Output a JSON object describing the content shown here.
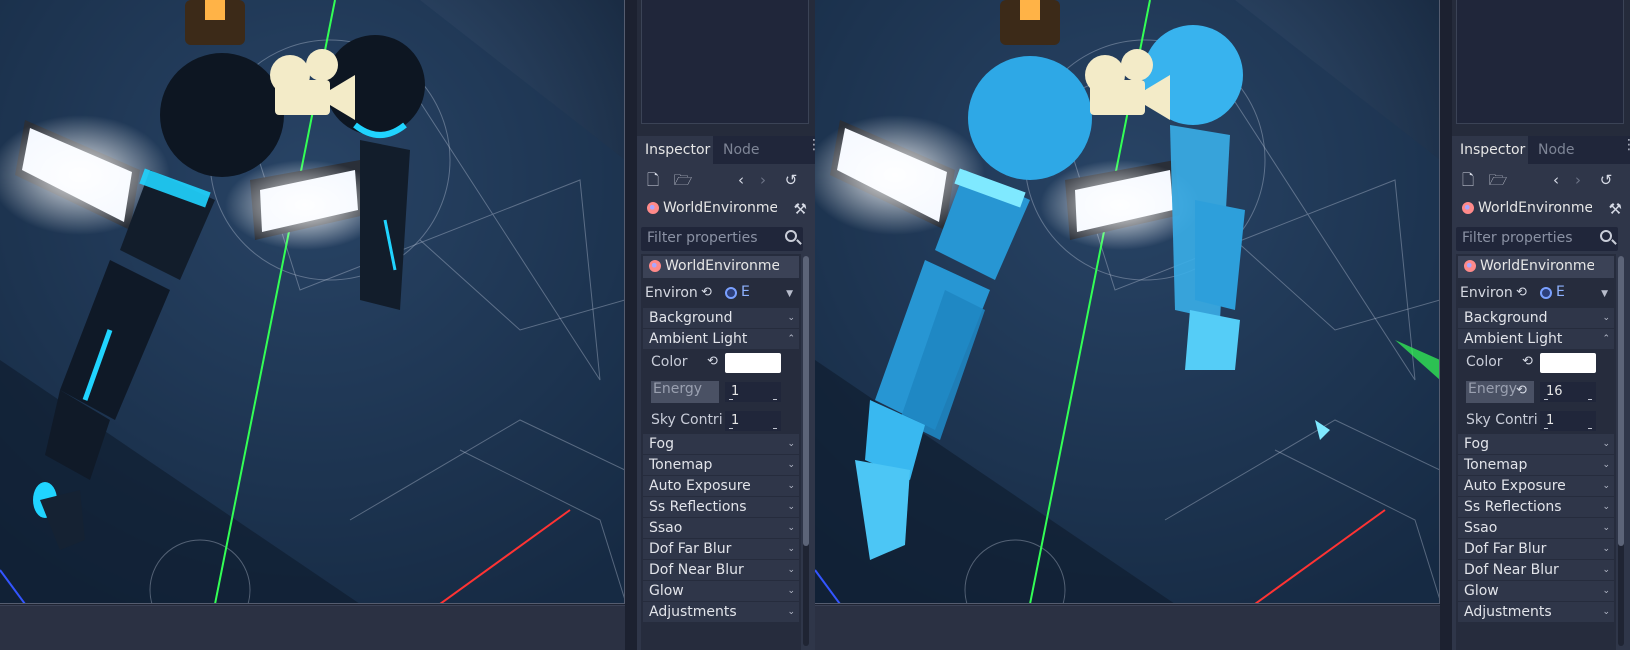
{
  "panels": [
    {
      "id": "before",
      "inspector": {
        "tab_active": "Inspector",
        "tab_inactive": "Node",
        "object_name": "WorldEnvironme",
        "filter_placeholder": "Filter properties",
        "header_name": "WorldEnvironment",
        "environment_label": "Environ",
        "environment_value": "E",
        "sections_top": [
          "Background",
          "Ambient Light"
        ],
        "ambient": {
          "color_label": "Color",
          "color_value": "#ffffff",
          "energy_label": "Energy",
          "energy_value": "1",
          "sky_label": "Sky Contri",
          "sky_value": "1"
        },
        "sections_bottom": [
          "Fog",
          "Tonemap",
          "Auto Exposure",
          "Ss Reflections",
          "Ssao",
          "Dof Far Blur",
          "Dof Near Blur",
          "Glow",
          "Adjustments"
        ]
      },
      "scene": {
        "arm_color": "#0a1220",
        "accent": "#20d4ff"
      }
    },
    {
      "id": "after",
      "inspector": {
        "tab_active": "Inspector",
        "tab_inactive": "Node",
        "object_name": "WorldEnvironme",
        "filter_placeholder": "Filter properties",
        "header_name": "WorldEnvironment",
        "environment_label": "Environ",
        "environment_value": "E",
        "sections_top": [
          "Background",
          "Ambient Light"
        ],
        "ambient": {
          "color_label": "Color",
          "color_value": "#ffffff",
          "energy_label": "Energy",
          "energy_value": "16",
          "sky_label": "Sky Contri",
          "sky_value": "1"
        },
        "sections_bottom": [
          "Fog",
          "Tonemap",
          "Auto Exposure",
          "Ss Reflections",
          "Ssao",
          "Dof Far Blur",
          "Dof Near Blur",
          "Glow",
          "Adjustments"
        ]
      },
      "scene": {
        "arm_color": "#2ea8e6",
        "accent": "#7fe9ff"
      }
    }
  ],
  "icons": {
    "new_resource": "new-resource-icon",
    "open_resource": "open-resource-icon",
    "back": "back-arrow-icon",
    "forward": "forward-arrow-icon",
    "history": "history-icon",
    "object": "world-environment-icon",
    "tools": "object-tools-icon",
    "search": "search-icon",
    "reset": "reset-revert-icon",
    "collapse": "chevron-icon",
    "menu": "kebab-menu-icon",
    "camera": "camera-gizmo-icon"
  }
}
